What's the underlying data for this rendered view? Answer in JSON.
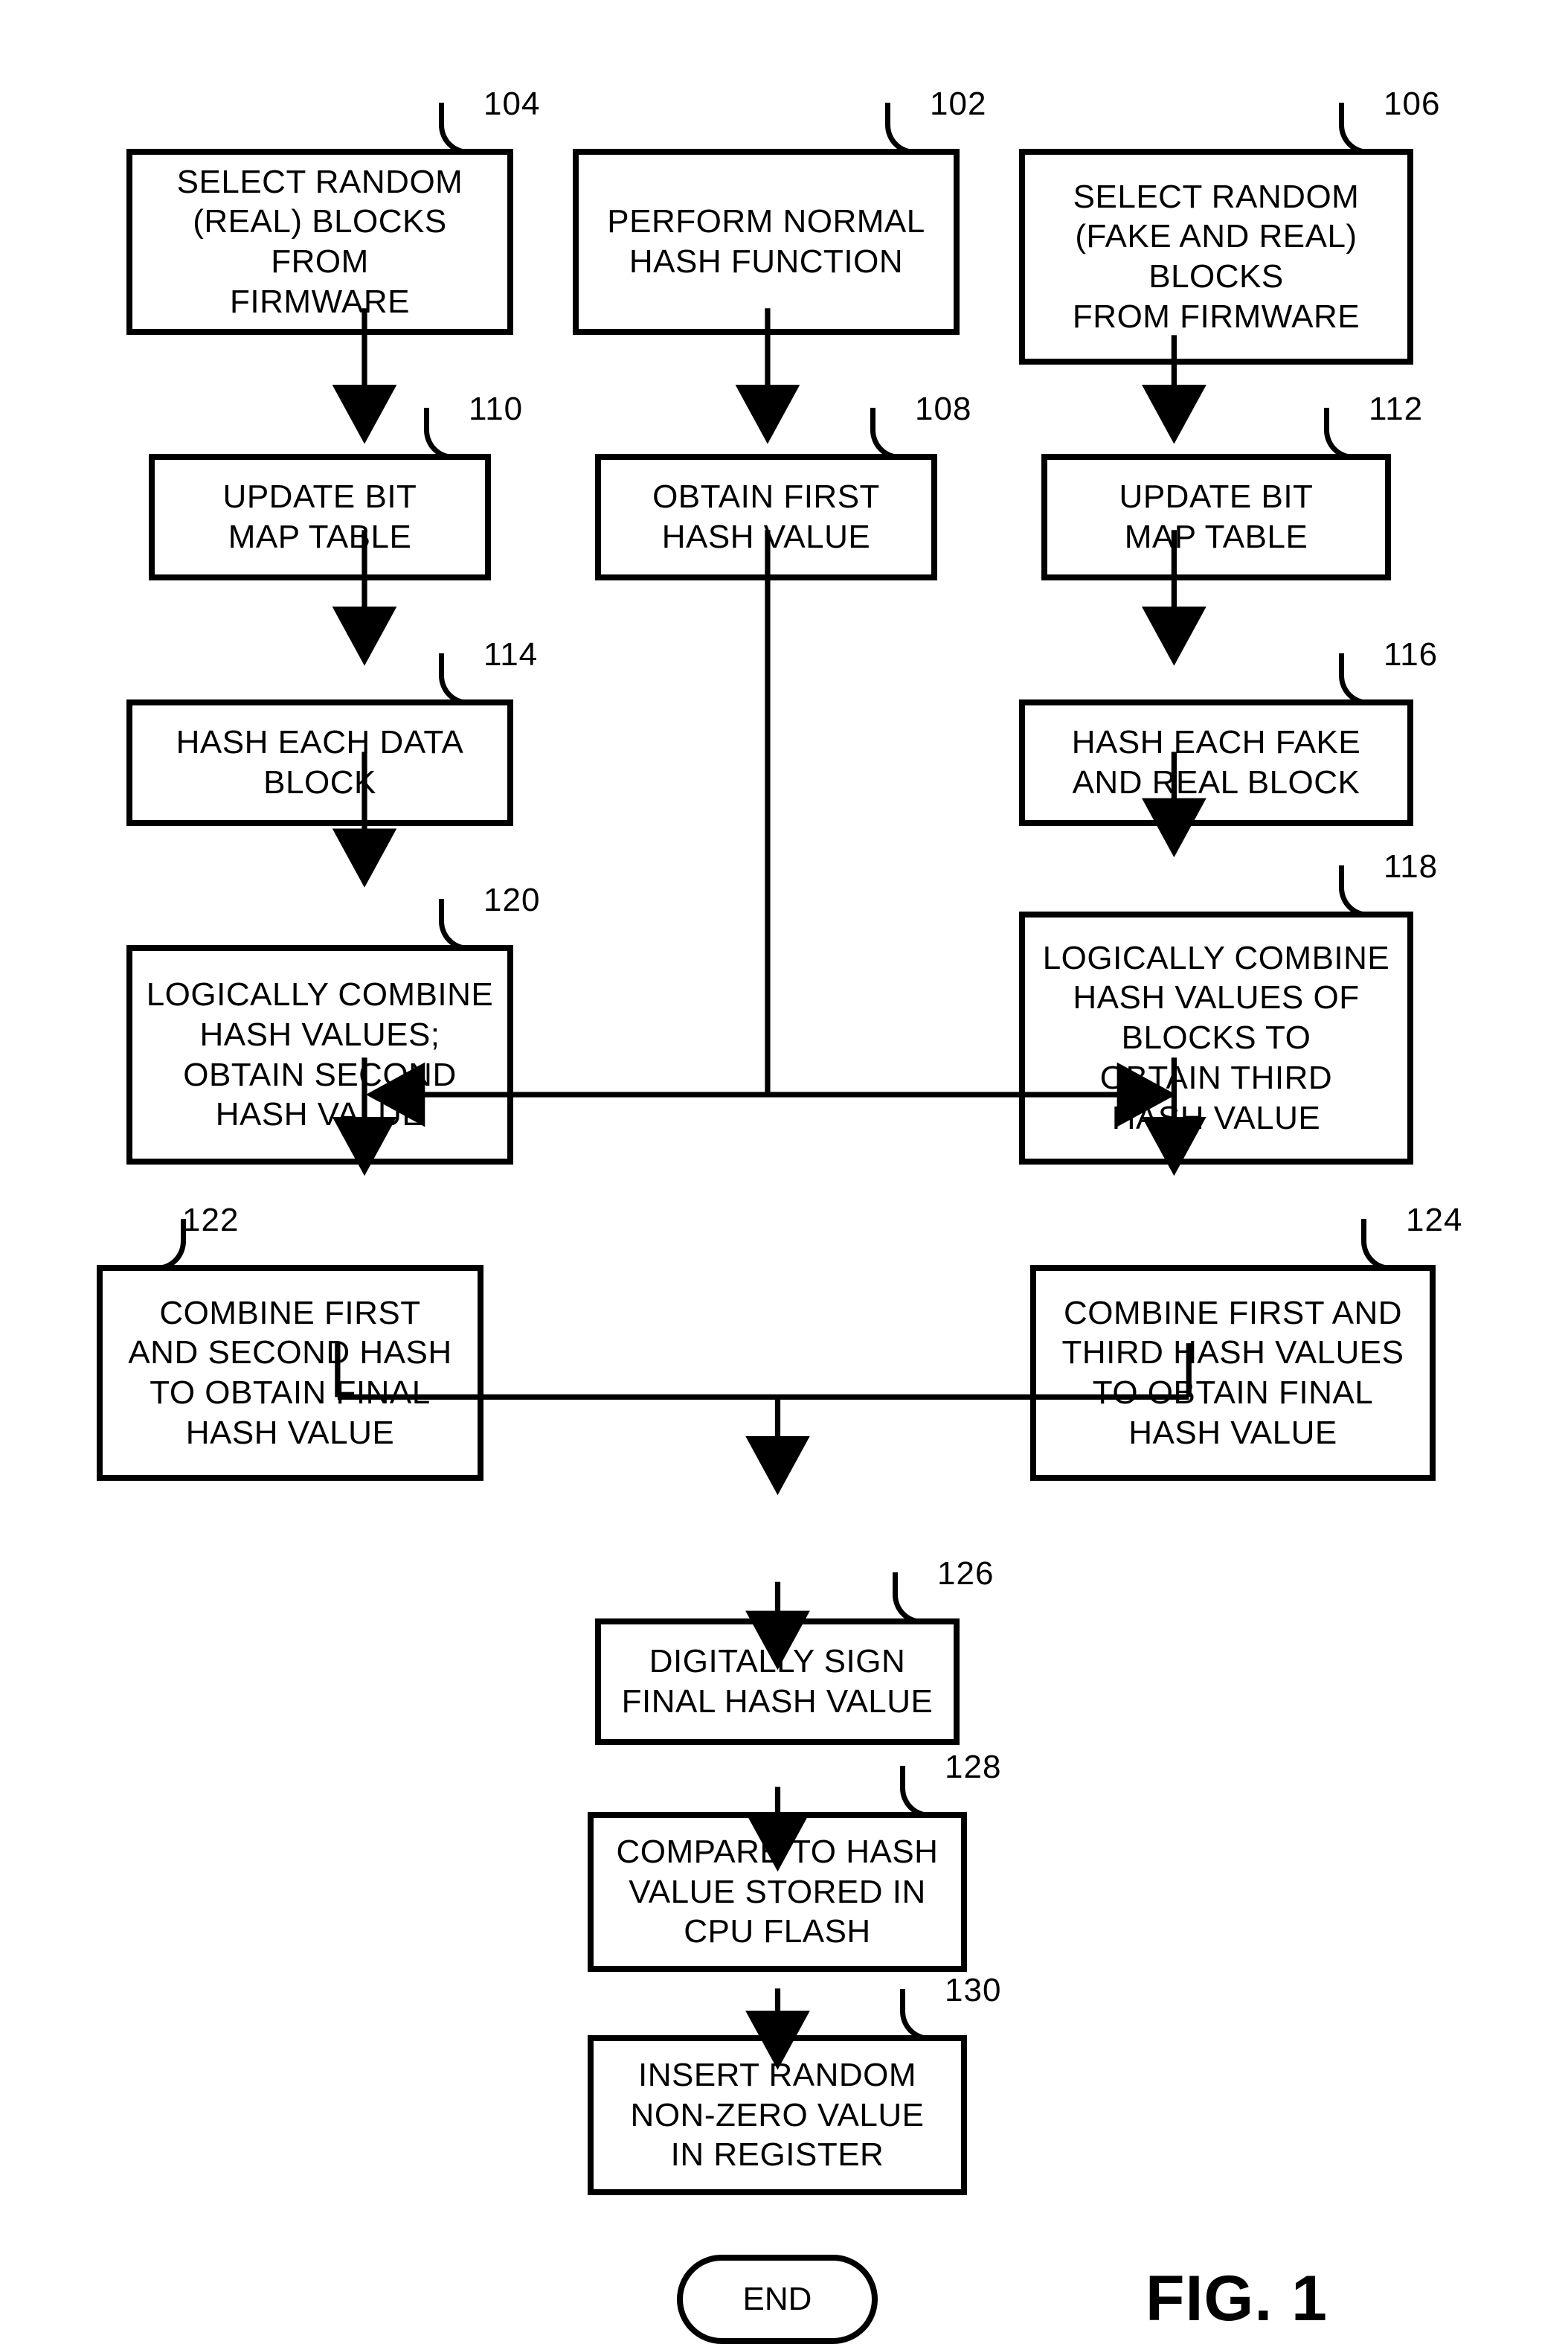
{
  "title": "FIG. 1",
  "end_label": "END",
  "boxes": {
    "n102": {
      "text": "PERFORM NORMAL\nHASH FUNCTION",
      "ref": "102"
    },
    "n104": {
      "text": "SELECT RANDOM\n(REAL) BLOCKS FROM\nFIRMWARE",
      "ref": "104"
    },
    "n106": {
      "text": "SELECT RANDOM\n(FAKE AND REAL)\nBLOCKS\nFROM FIRMWARE",
      "ref": "106"
    },
    "n108": {
      "text": "OBTAIN FIRST\nHASH VALUE",
      "ref": "108"
    },
    "n110": {
      "text": "UPDATE BIT\nMAP TABLE",
      "ref": "110"
    },
    "n112": {
      "text": "UPDATE BIT\nMAP TABLE",
      "ref": "112"
    },
    "n114": {
      "text": "HASH EACH DATA\nBLOCK",
      "ref": "114"
    },
    "n116": {
      "text": "HASH EACH FAKE\nAND REAL BLOCK",
      "ref": "116"
    },
    "n118": {
      "text": "LOGICALLY COMBINE\nHASH VALUES OF\nBLOCKS TO\nOBTAIN THIRD\nHASH VALUE",
      "ref": "118"
    },
    "n120": {
      "text": "LOGICALLY COMBINE\nHASH VALUES;\nOBTAIN SECOND\nHASH VALUE",
      "ref": "120"
    },
    "n122": {
      "text": "COMBINE FIRST\nAND SECOND HASH\nTO OBTAIN FINAL\nHASH VALUE",
      "ref": "122"
    },
    "n124": {
      "text": "COMBINE FIRST AND\nTHIRD HASH VALUES\nTO OBTAIN FINAL\nHASH VALUE",
      "ref": "124"
    },
    "n126": {
      "text": "DIGITALLY SIGN\nFINAL HASH VALUE",
      "ref": "126"
    },
    "n128": {
      "text": "COMPARE TO HASH\nVALUE STORED IN\nCPU FLASH",
      "ref": "128"
    },
    "n130": {
      "text": "INSERT RANDOM\nNON-ZERO VALUE\nIN REGISTER",
      "ref": "130"
    }
  }
}
